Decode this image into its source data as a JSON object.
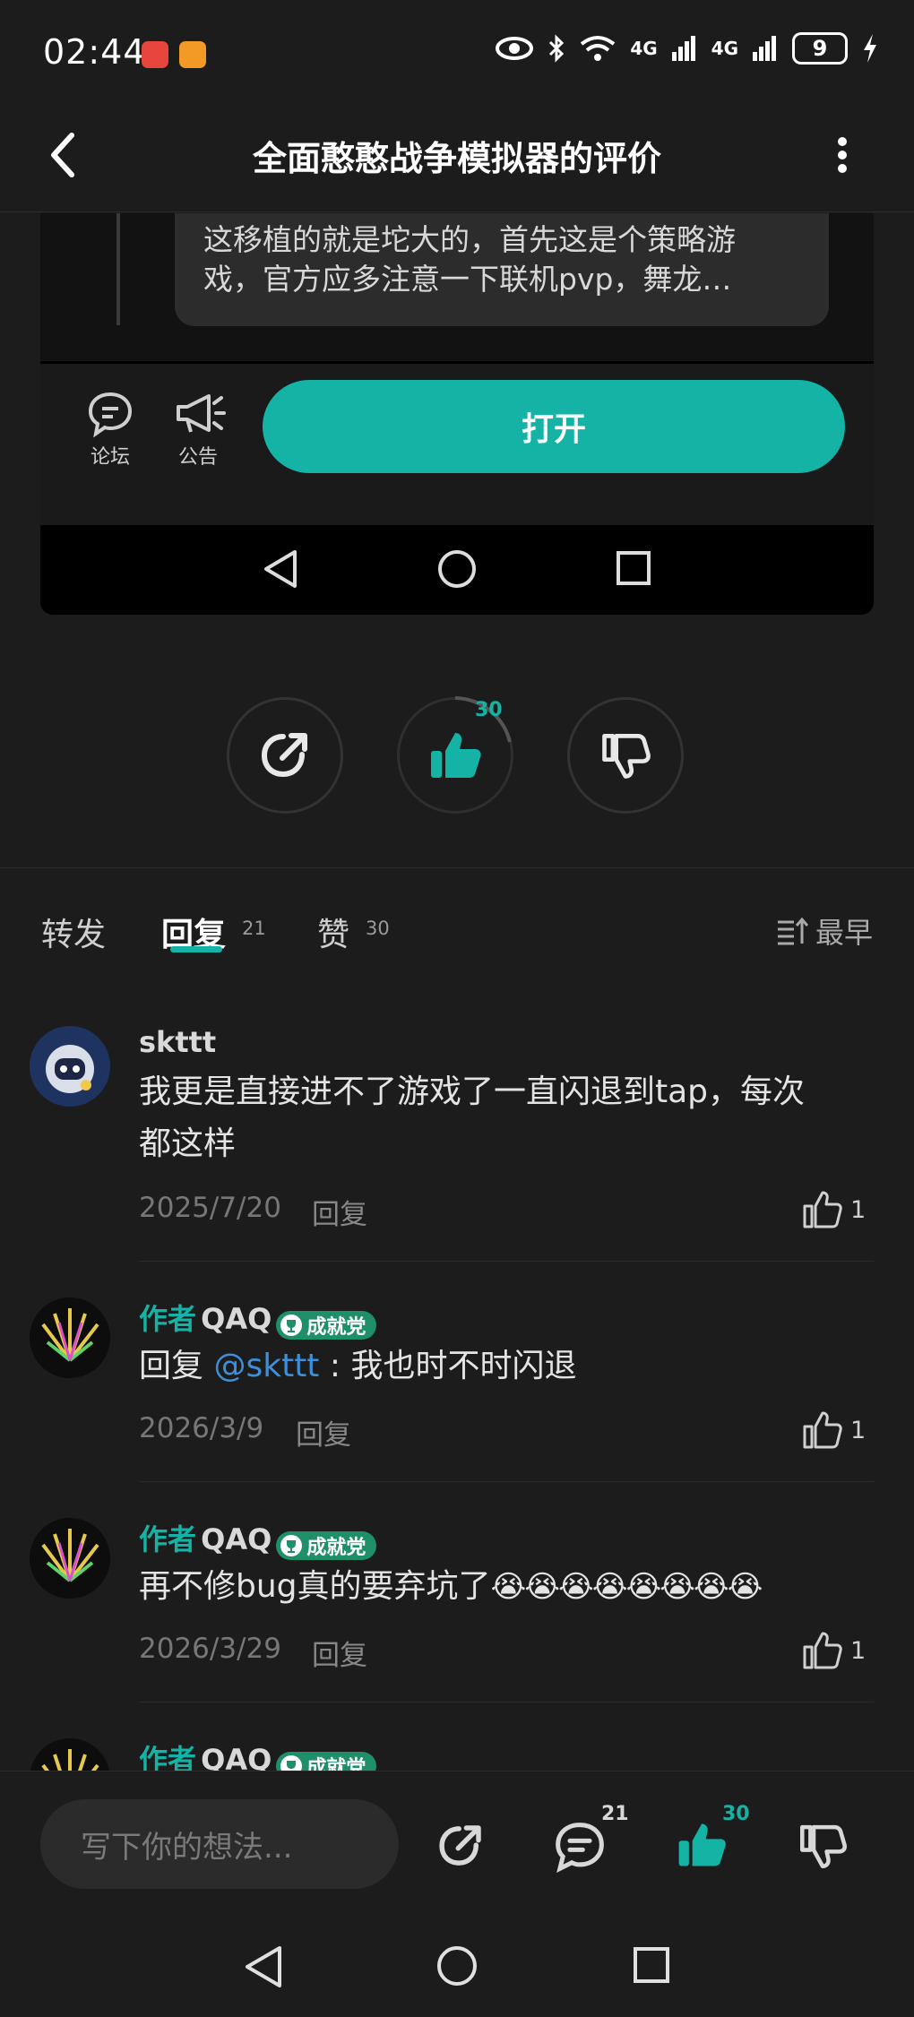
{
  "status": {
    "time": "02:44",
    "battery": "9",
    "net1": "4G",
    "net2": "4G"
  },
  "header": {
    "title": "全面憨憨战争模拟器的评价"
  },
  "embed": {
    "quote_line1": "这移植的就是坨大的，首先这是个策略游",
    "quote_line2": "戏，官方应多注意一下联机pvp，舞龙…",
    "forum_label": "论坛",
    "notice_label": "公告",
    "open_label": "打开"
  },
  "actions": {
    "like_count": "30"
  },
  "tabs": {
    "repost": "转发",
    "reply": "回复",
    "reply_count": "21",
    "like": "赞",
    "like_count": "30",
    "sort": "最早"
  },
  "comments": [
    {
      "user": "skttt",
      "line1": "我更是直接进不了游戏了一直闪退到tap，每次",
      "line2": "都这样",
      "date": "2025/7/20",
      "reply": "回复",
      "likes": "1"
    },
    {
      "author_tag": "作者",
      "user": "QAQ",
      "badge": "成就党",
      "prefix": "回复",
      "mention": "@skttt",
      "text": " : 我也时不时闪退",
      "date": "2026/3/9",
      "reply": "回复",
      "likes": "1"
    },
    {
      "author_tag": "作者",
      "user": "QAQ",
      "badge": "成就党",
      "text": "再不修bug真的要弃坑了",
      "emoji": "😭😭😭😭😭😭😭😭",
      "date": "2026/3/29",
      "reply": "回复",
      "likes": "1"
    },
    {
      "author_tag": "作者",
      "user": "QAQ",
      "badge": "成就党"
    }
  ],
  "bottom": {
    "placeholder": "写下你的想法...",
    "comment_count": "21",
    "like_count": "30"
  },
  "colors": {
    "accent": "#14b3a6",
    "badge": "#1f8f6a",
    "mention": "#3d8fd9",
    "background": "#1c1c1c"
  }
}
